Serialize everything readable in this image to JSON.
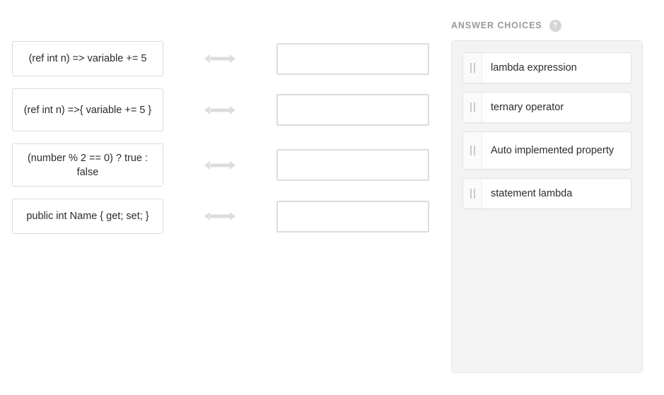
{
  "match": {
    "rows": [
      {
        "prompt": "(ref int n) => variable += 5",
        "connector_icon": "double-arrow-icon",
        "answer_value": ""
      },
      {
        "prompt": "(ref int n) =>{ variable += 5 }",
        "connector_icon": "double-arrow-icon",
        "answer_value": ""
      },
      {
        "prompt": "(number % 2 == 0) ? true : false",
        "connector_icon": "double-arrow-icon",
        "answer_value": ""
      },
      {
        "prompt": "public int Name { get; set; }",
        "connector_icon": "double-arrow-icon",
        "answer_value": ""
      }
    ]
  },
  "answers": {
    "header": "ANSWER CHOICES",
    "help_icon_glyph": "?",
    "help_icon_name": "help-icon",
    "choices": [
      {
        "label": "lambda expression"
      },
      {
        "label": "ternary operator"
      },
      {
        "label": "Auto implemented property"
      },
      {
        "label": "statement lambda"
      }
    ]
  },
  "colors": {
    "page_background": "#ffffff",
    "panel_background": "#f3f3f3",
    "card_border": "#dadada",
    "dropzone_border": "#dddddd",
    "arrow": "#dcdcdc",
    "header_text": "#9a9a9a",
    "body_text": "#2b2b2b",
    "handle_bar": "#c9c9c9"
  }
}
